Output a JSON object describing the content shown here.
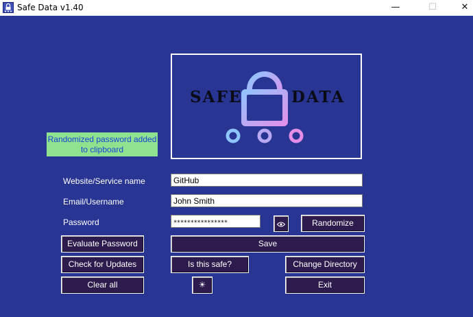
{
  "window": {
    "title": "Safe Data v1.40",
    "icon": "app-icon",
    "controls": {
      "minimize": "—",
      "maximize": "☐",
      "close": "✕"
    }
  },
  "logo": {
    "word_left": "SAFE",
    "word_right": "DATA",
    "icon": "padlock-network-icon"
  },
  "notice": "Randomized password added to clipboard",
  "form": {
    "website_label": "Website/Service name",
    "website_value": "GitHub",
    "email_label": "Email/Username",
    "email_value": "John Smith",
    "password_label": "Password",
    "password_value": "****************"
  },
  "buttons": {
    "show_password_icon": "eye-icon",
    "randomize": "Randomize",
    "evaluate": "Evaluate Password",
    "save": "Save",
    "check_updates": "Check for Updates",
    "is_safe": "Is this safe?",
    "change_directory": "Change Directory",
    "clear_all": "Clear all",
    "theme_icon": "sun-icon",
    "theme_glyph": "☀",
    "exit": "Exit"
  },
  "colors": {
    "background": "#283593",
    "button": "#2d1b4e",
    "notice_bg": "#8fe38f",
    "notice_text": "#1a40d8"
  }
}
